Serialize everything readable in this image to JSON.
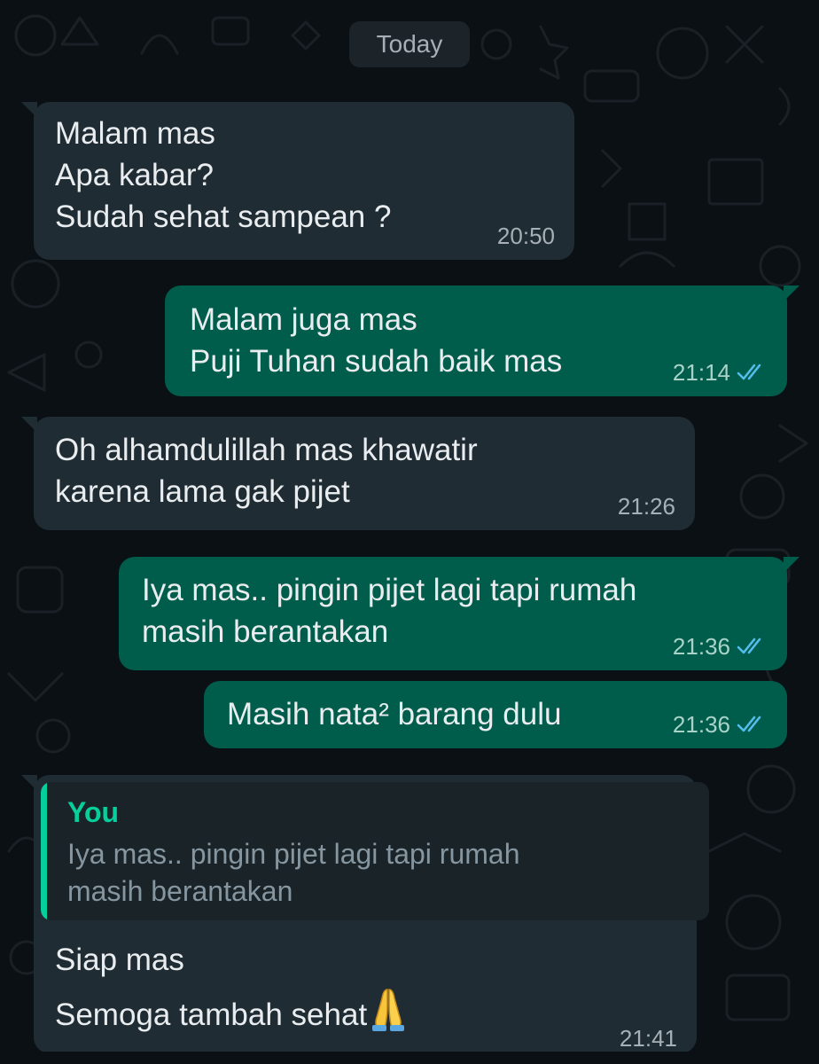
{
  "date_chip": "Today",
  "messages": [
    {
      "direction": "in",
      "text": "Malam mas\nApa kabar?\nSudah sehat sampean ?",
      "time": "20:50"
    },
    {
      "direction": "out",
      "text": "Malam juga mas\nPuji Tuhan sudah baik mas",
      "time": "21:14",
      "status": "read"
    },
    {
      "direction": "in",
      "text": "Oh alhamdulillah mas khawatir\nkarena lama gak pijet",
      "time": "21:26"
    },
    {
      "direction": "out",
      "text": "Iya mas.. pingin pijet lagi tapi rumah\nmasih berantakan",
      "time": "21:36",
      "status": "read"
    },
    {
      "direction": "out",
      "text": "Masih nata² barang dulu",
      "time": "21:36",
      "status": "read"
    }
  ],
  "reply_message": {
    "direction": "in",
    "quote_author": "You",
    "quote_text": "Iya mas.. pingin pijet lagi tapi rumah\nmasih berantakan",
    "text": "Siap mas\nSemoga tambah sehat",
    "emoji": "folded-hands",
    "time": "21:41"
  },
  "colors": {
    "background": "#0b1014",
    "incoming_bubble": "#202c33",
    "outgoing_bubble": "#005c4b",
    "read_tick": "#53bdeb",
    "quote_accent": "#06cf9c"
  }
}
